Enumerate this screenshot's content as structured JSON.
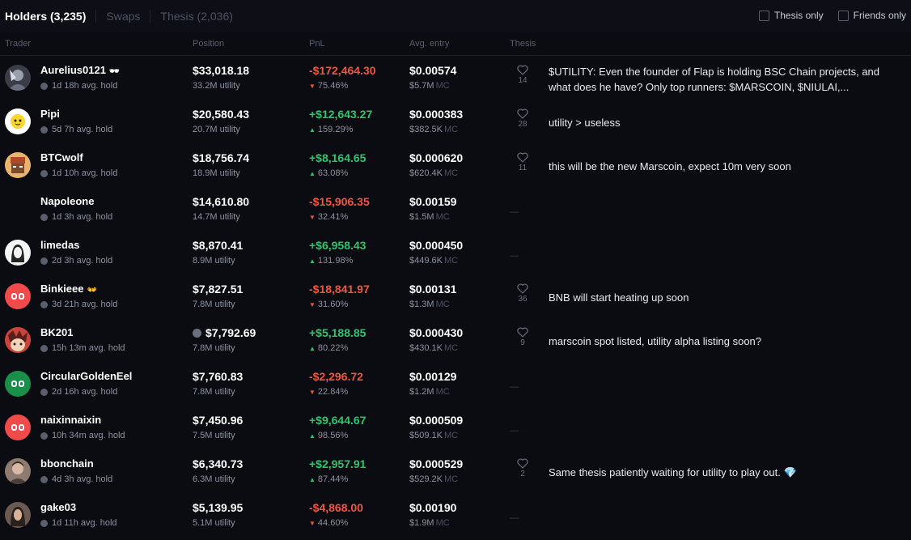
{
  "tabs": [
    {
      "label": "Holders (3,235)",
      "active": true
    },
    {
      "label": "Swaps",
      "active": false
    },
    {
      "label": "Thesis (2,036)",
      "active": false
    }
  ],
  "filters": {
    "thesis_only": "Thesis only",
    "friends_only": "Friends only"
  },
  "columns": {
    "trader": "Trader",
    "position": "Position",
    "pnl": "PnL",
    "avg_entry": "Avg. entry",
    "thesis": "Thesis"
  },
  "colors": {
    "positive": "#2ec46f",
    "negative": "#f0553f",
    "background": "#0b0c12"
  },
  "rows": [
    {
      "name": "Aurelius0121",
      "badge": "🕶",
      "hold": "1d 18h avg. hold",
      "position": "$33,018.18",
      "position_sub": "33.2M utility",
      "pnl": "-$172,464.30",
      "pnl_pct": "75.46%",
      "pnl_dir": "down",
      "entry": "$0.00574",
      "entry_mc": "$5.7M",
      "mc_label": "MC",
      "likes": "14",
      "thesis": "$UTILITY: Even the founder of Flap is holding BSC Chain projects, and what does he have? Only top runners: $MARSCOIN, $NIULAI,...",
      "avatar": "aurelius-avatar"
    },
    {
      "name": "Pipi",
      "hold": "5d 7h avg. hold",
      "position": "$20,580.43",
      "position_sub": "20.7M utility",
      "pnl": "+$12,643.27",
      "pnl_pct": "159.29%",
      "pnl_dir": "up",
      "entry": "$0.000383",
      "entry_mc": "$382.5K",
      "mc_label": "MC",
      "likes": "28",
      "thesis": "utility > useless",
      "avatar": "pipi-avatar"
    },
    {
      "name": "BTCwolf",
      "hold": "1d 10h avg. hold",
      "position": "$18,756.74",
      "position_sub": "18.9M utility",
      "pnl": "+$8,164.65",
      "pnl_pct": "63.08%",
      "pnl_dir": "up",
      "entry": "$0.000620",
      "entry_mc": "$620.4K",
      "mc_label": "MC",
      "likes": "11",
      "thesis": "this will be the new Marscoin, expect 10m very soon",
      "avatar": "btcwolf-avatar"
    },
    {
      "name": "Napoleone",
      "hold": "1d 3h avg. hold",
      "position": "$14,610.80",
      "position_sub": "14.7M utility",
      "pnl": "-$15,906.35",
      "pnl_pct": "32.41%",
      "pnl_dir": "down",
      "entry": "$0.00159",
      "entry_mc": "$1.5M",
      "mc_label": "MC",
      "dash": "—",
      "avatar": "none"
    },
    {
      "name": "limedas",
      "hold": "2d 3h avg. hold",
      "position": "$8,870.41",
      "position_sub": "8.9M utility",
      "pnl": "+$6,958.43",
      "pnl_pct": "131.98%",
      "pnl_dir": "up",
      "entry": "$0.000450",
      "entry_mc": "$449.6K",
      "mc_label": "MC",
      "dash": "—",
      "avatar": "limedas-avatar"
    },
    {
      "name": "Binkieee",
      "badge": "👐",
      "hold": "3d 21h avg. hold",
      "position": "$7,827.51",
      "position_sub": "7.8M utility",
      "pnl": "-$18,841.97",
      "pnl_pct": "31.60%",
      "pnl_dir": "down",
      "entry": "$0.00131",
      "entry_mc": "$1.3M",
      "mc_label": "MC",
      "likes": "36",
      "thesis": "BNB will start heating up soon",
      "avatar": "red-avatar"
    },
    {
      "name": "BK201",
      "hold": "15h 13m avg. hold",
      "position": "$7,792.69",
      "position_sub": "7.8M utility",
      "pnl": "+$5,188.85",
      "pnl_pct": "80.22%",
      "pnl_dir": "up",
      "entry": "$0.000430",
      "entry_mc": "$430.1K",
      "mc_label": "MC",
      "likes": "9",
      "thesis": "marscoin spot listed, utility alpha listing soon?",
      "avatar": "bk201-avatar",
      "coin_icon": true
    },
    {
      "name": "CircularGoldenEel",
      "hold": "2d 16h avg. hold",
      "position": "$7,760.83",
      "position_sub": "7.8M utility",
      "pnl": "-$2,296.72",
      "pnl_pct": "22.84%",
      "pnl_dir": "down",
      "entry": "$0.00129",
      "entry_mc": "$1.2M",
      "mc_label": "MC",
      "dash": "—",
      "avatar": "green-avatar"
    },
    {
      "name": "naixinnaixin",
      "hold": "10h 34m avg. hold",
      "position": "$7,450.96",
      "position_sub": "7.5M utility",
      "pnl": "+$9,644.67",
      "pnl_pct": "98.56%",
      "pnl_dir": "up",
      "entry": "$0.000509",
      "entry_mc": "$509.1K",
      "mc_label": "MC",
      "dash": "—",
      "avatar": "red-avatar"
    },
    {
      "name": "bbonchain",
      "hold": "4d 3h avg. hold",
      "position": "$6,340.73",
      "position_sub": "6.3M utility",
      "pnl": "+$2,957.91",
      "pnl_pct": "87.44%",
      "pnl_dir": "up",
      "entry": "$0.000529",
      "entry_mc": "$529.2K",
      "mc_label": "MC",
      "likes": "2",
      "thesis": "Same thesis patiently waiting for utility to play out. 💎",
      "avatar": "bbonchain-avatar"
    },
    {
      "name": "gake03",
      "hold": "1d 11h avg. hold",
      "position": "$5,139.95",
      "position_sub": "5.1M utility",
      "pnl": "-$4,868.00",
      "pnl_pct": "44.60%",
      "pnl_dir": "down",
      "entry": "$0.00190",
      "entry_mc": "$1.9M",
      "mc_label": "MC",
      "dash": "—",
      "avatar": "gake-avatar"
    }
  ]
}
